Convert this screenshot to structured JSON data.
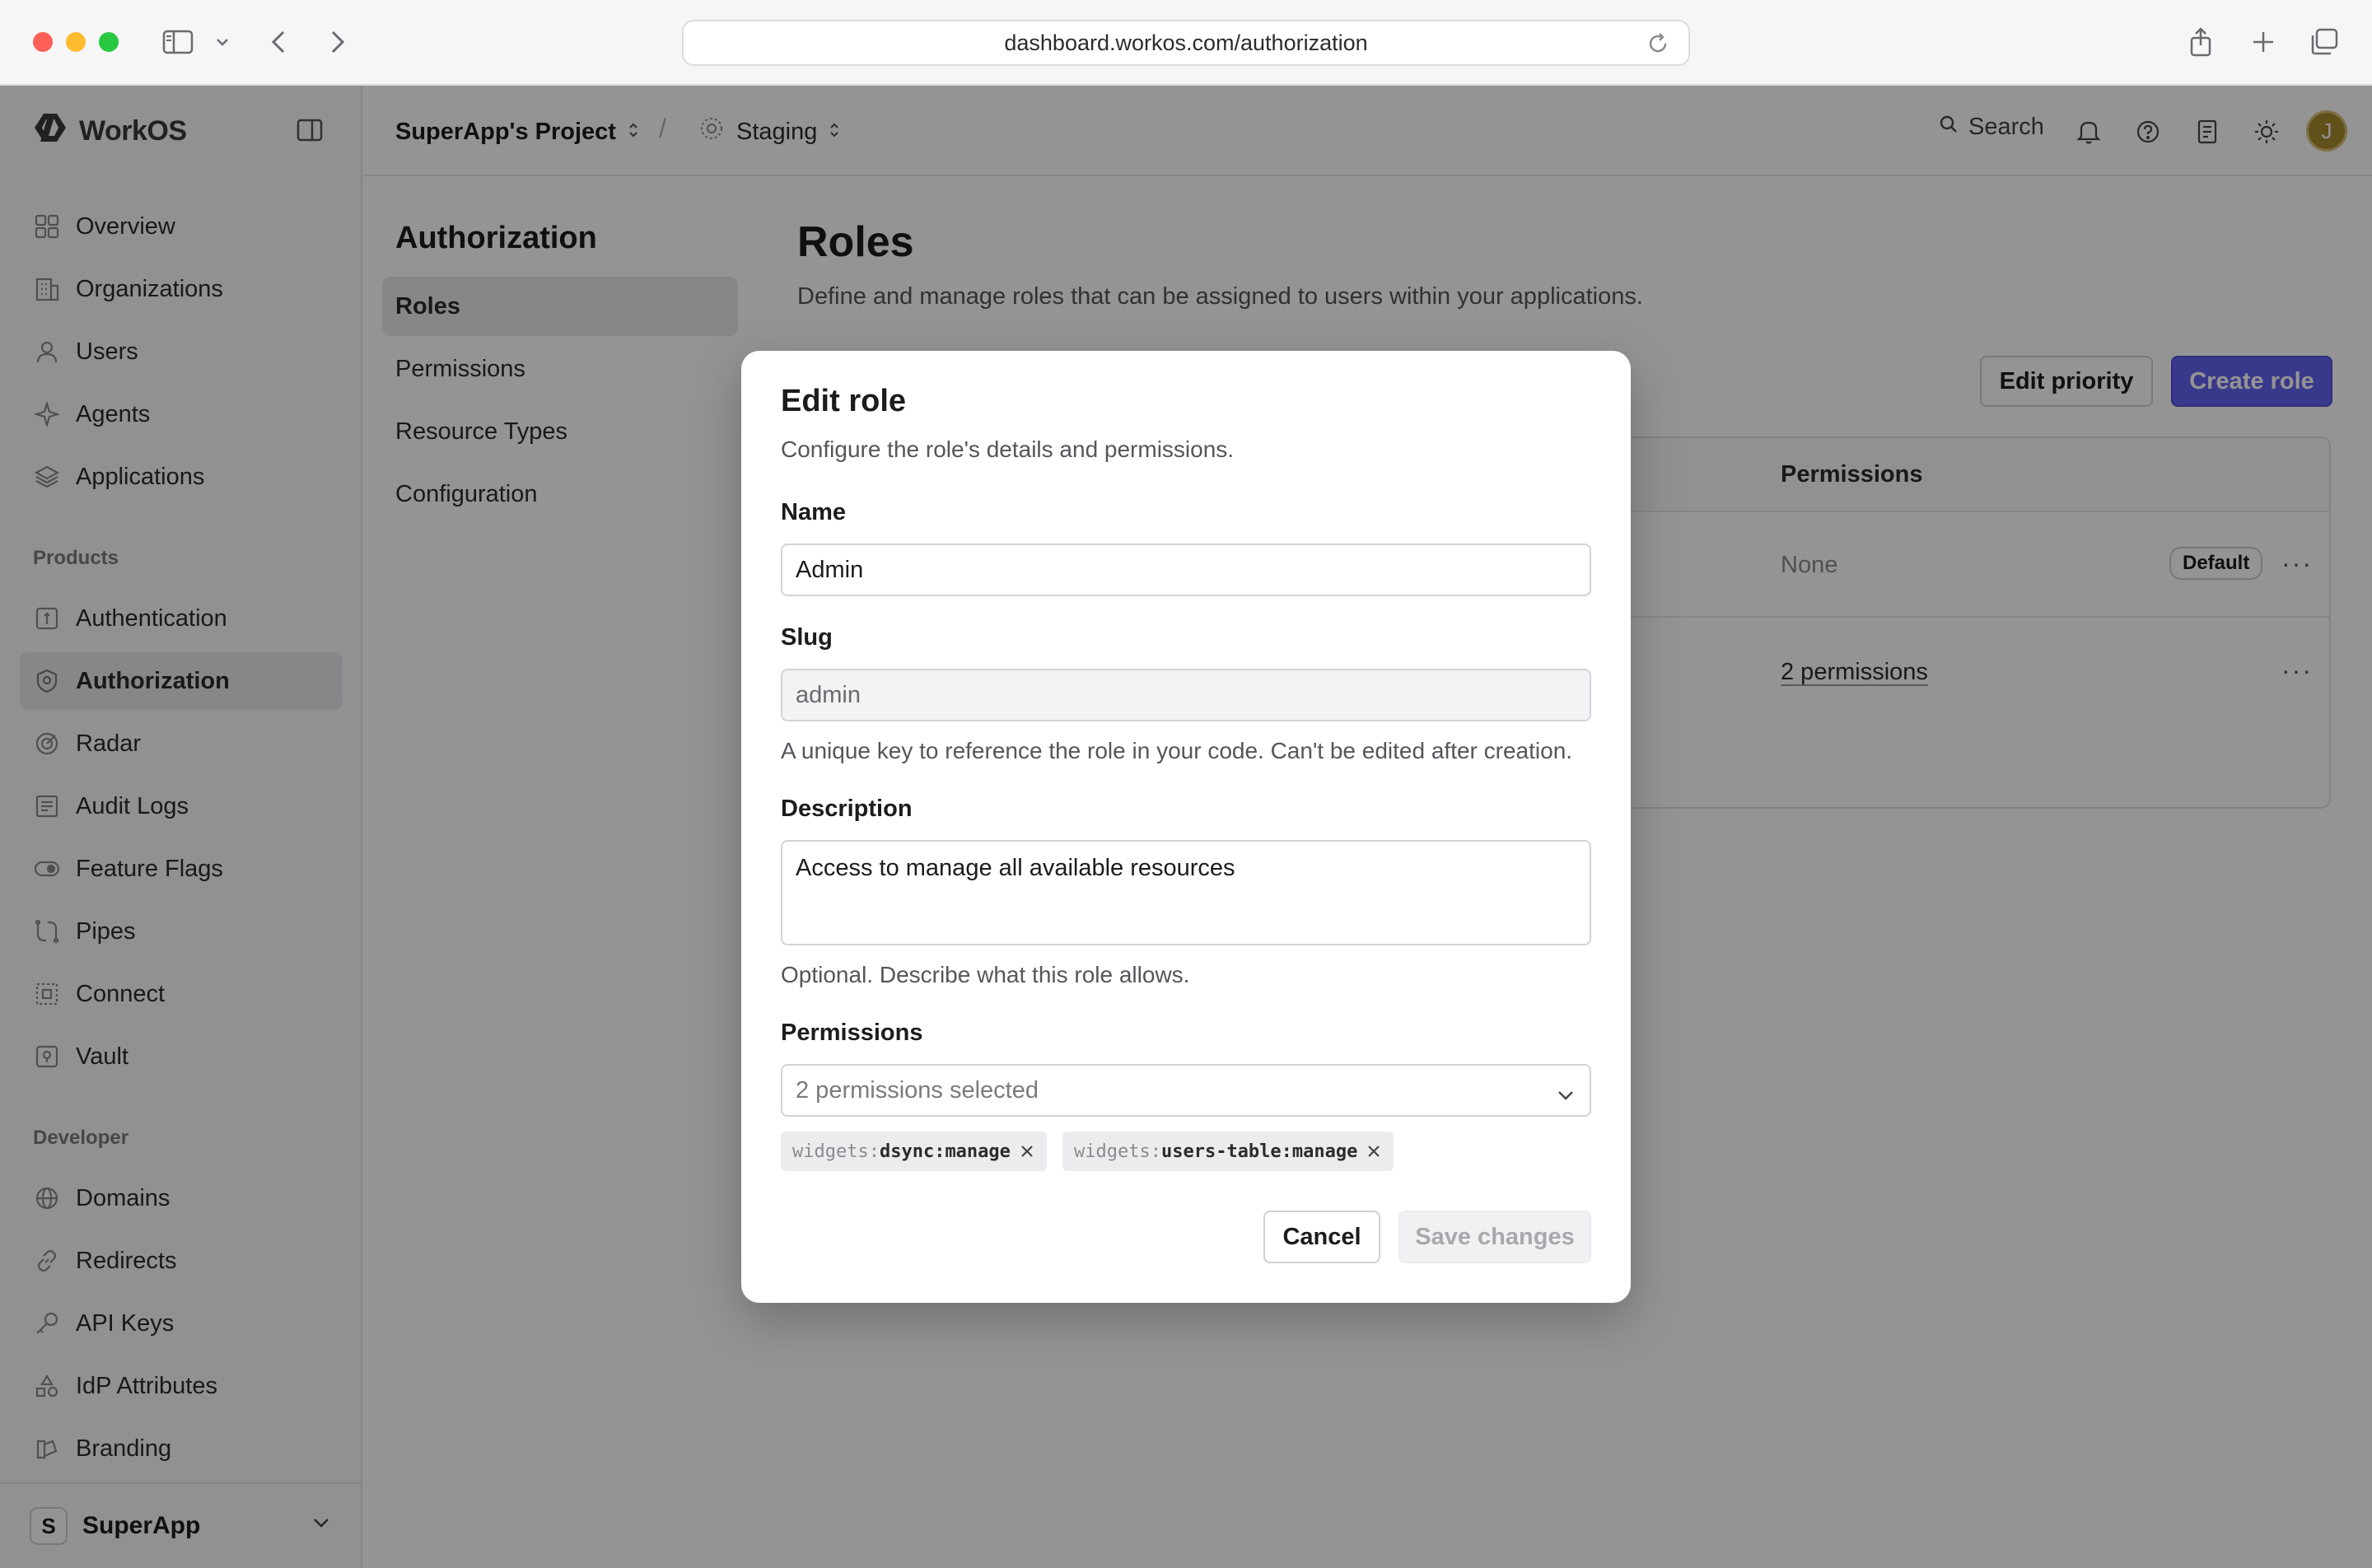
{
  "browser": {
    "url": "dashboard.workos.com/authorization"
  },
  "sidebar": {
    "brand": "WorkOS",
    "main_items": [
      {
        "label": "Overview",
        "icon": "grid-icon"
      },
      {
        "label": "Organizations",
        "icon": "building-icon"
      },
      {
        "label": "Users",
        "icon": "user-icon"
      },
      {
        "label": "Agents",
        "icon": "sparkle-icon"
      },
      {
        "label": "Applications",
        "icon": "layers-icon"
      }
    ],
    "products_label": "Products",
    "product_items": [
      {
        "label": "Authentication",
        "icon": "key-box-icon"
      },
      {
        "label": "Authorization",
        "icon": "shield-icon",
        "active": true
      },
      {
        "label": "Radar",
        "icon": "radar-icon"
      },
      {
        "label": "Audit Logs",
        "icon": "log-icon"
      },
      {
        "label": "Feature Flags",
        "icon": "toggle-icon"
      },
      {
        "label": "Pipes",
        "icon": "pipes-icon"
      },
      {
        "label": "Connect",
        "icon": "connect-icon"
      },
      {
        "label": "Vault",
        "icon": "vault-icon"
      }
    ],
    "developer_label": "Developer",
    "developer_items": [
      {
        "label": "Domains",
        "icon": "globe-icon"
      },
      {
        "label": "Redirects",
        "icon": "link-icon"
      },
      {
        "label": "API Keys",
        "icon": "key-icon"
      },
      {
        "label": "IdP Attributes",
        "icon": "shapes-icon"
      },
      {
        "label": "Branding",
        "icon": "brush-icon"
      }
    ],
    "org": {
      "initial": "S",
      "name": "SuperApp"
    }
  },
  "topbar": {
    "project": "SuperApp's Project",
    "separator": "/",
    "environment": "Staging",
    "search_label": "Search",
    "user_initial": "J"
  },
  "subnav": {
    "title": "Authorization",
    "items": [
      {
        "label": "Roles",
        "active": true
      },
      {
        "label": "Permissions"
      },
      {
        "label": "Resource Types"
      },
      {
        "label": "Configuration"
      }
    ]
  },
  "page": {
    "title": "Roles",
    "description": "Define and manage roles that can be assigned to users within your applications.",
    "edit_priority_label": "Edit priority",
    "create_role_label": "Create role",
    "table": {
      "permissions_header": "Permissions",
      "rows": [
        {
          "permissions": "None",
          "badge": "Default",
          "more": "···"
        },
        {
          "permissions": "2 permissions",
          "more": "···"
        }
      ]
    }
  },
  "modal": {
    "title": "Edit role",
    "subtitle": "Configure the role's details and permissions.",
    "name_label": "Name",
    "name_value": "Admin",
    "slug_label": "Slug",
    "slug_value": "admin",
    "slug_help": "A unique key to reference the role in your code. Can't be edited after creation.",
    "description_label": "Description",
    "description_value": "Access to manage all available resources",
    "description_help": "Optional. Describe what this role allows.",
    "permissions_label": "Permissions",
    "permissions_select": "2 permissions selected",
    "chips": [
      {
        "ns": "widgets:",
        "rest": "dsync:manage"
      },
      {
        "ns": "widgets:",
        "rest": "users-table:manage"
      }
    ],
    "cancel_label": "Cancel",
    "save_label": "Save changes"
  },
  "colors": {
    "primary": "#6363f1",
    "overlay": "rgba(0,0,0,0.42)"
  }
}
